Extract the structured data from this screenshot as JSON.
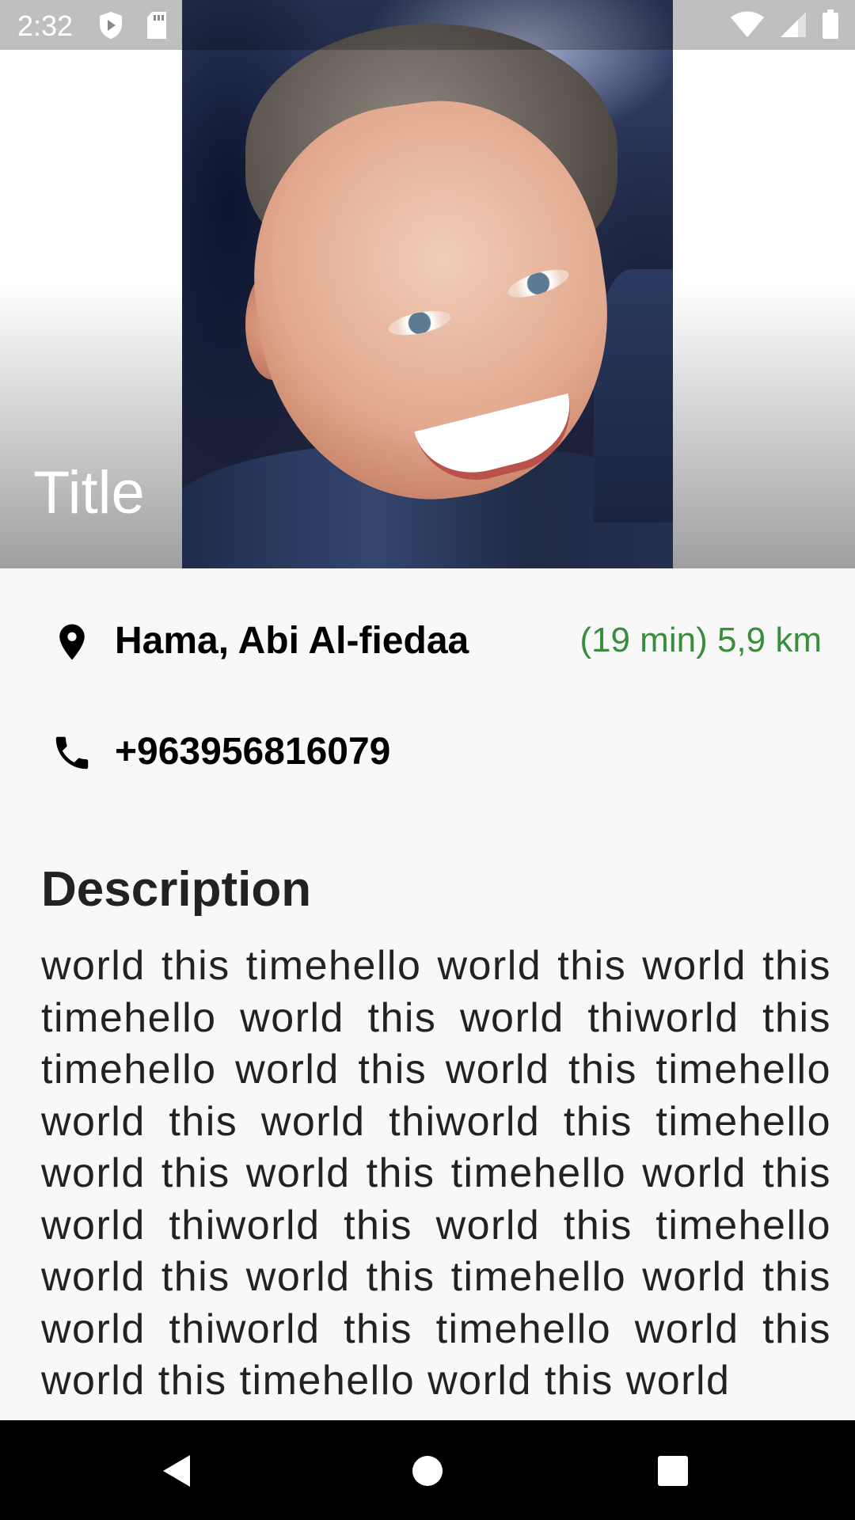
{
  "status_bar": {
    "time": "2:32",
    "icons": [
      "play-protect-icon",
      "sd-card-icon",
      "wifi-icon",
      "signal-icon",
      "battery-icon"
    ]
  },
  "header": {
    "title": "Title",
    "image": "profile-photo"
  },
  "location": {
    "icon": "location-pin-icon",
    "address": "Hama, Abi Al-fiedaa",
    "distance": "(19 min) 5,9 km",
    "distance_color": "#388e3c"
  },
  "phone": {
    "icon": "phone-icon",
    "number": "+963956816079"
  },
  "description": {
    "heading": "Description",
    "body": " world this timehello world this world this timehello world this world thiworld this timehello world this world this timehello world this world thiworld this timehello world this world this timehello world this world thiworld this world this timehello world this world this timehello world this world thiworld this timehello world this world this timehello world this world"
  },
  "nav_bar": {
    "buttons": [
      "back-icon",
      "home-icon",
      "recents-icon"
    ]
  }
}
